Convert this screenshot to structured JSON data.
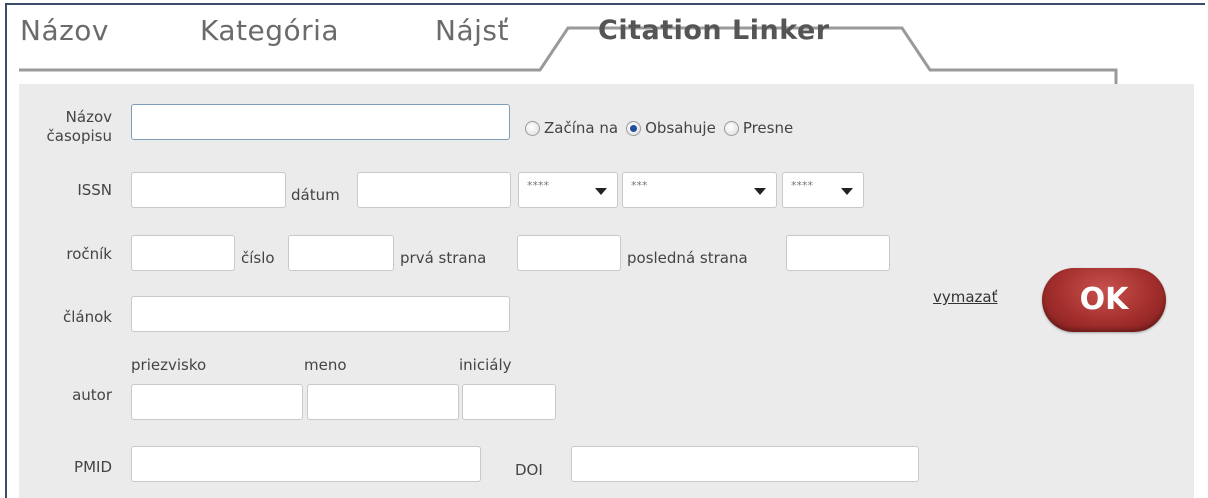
{
  "tabs": [
    {
      "label": "Názov"
    },
    {
      "label": "Kategória"
    },
    {
      "label": "Nájsť"
    },
    {
      "label": "Citation Linker",
      "active": true
    }
  ],
  "form": {
    "journal_title_label_1": "Názov",
    "journal_title_label_2": "časopisu",
    "journal_title_value": "",
    "match_options": [
      {
        "label": "Začína na",
        "checked": false
      },
      {
        "label": "Obsahuje",
        "checked": true
      },
      {
        "label": "Presne",
        "checked": false
      }
    ],
    "issn_label": "ISSN",
    "date_label": "dátum",
    "date_selects": [
      {
        "value": "****"
      },
      {
        "value": "***"
      },
      {
        "value": "****"
      }
    ],
    "volume_label": "ročník",
    "issue_label": "číslo",
    "start_page_label": "prvá strana",
    "end_page_label": "posledná strana",
    "article_label": "článok",
    "author_label": "autor",
    "surname_label": "priezvisko",
    "firstname_label": "meno",
    "initials_label": "iniciály",
    "pmid_label": "PMID",
    "doi_label": "DOI"
  },
  "actions": {
    "clear_label": "vymazať",
    "ok_label": "OK"
  },
  "colors": {
    "panel_bg": "#ebebeb",
    "frame_border": "#3b4c6b",
    "ok_button": "#a32f2d"
  }
}
